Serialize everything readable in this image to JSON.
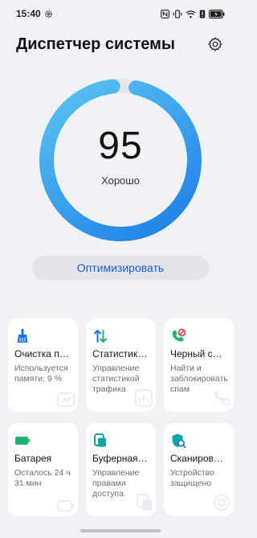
{
  "status_bar": {
    "time": "15:40",
    "icons": [
      "gear-icon",
      "nfc-icon",
      "vibrate-icon",
      "wifi-icon",
      "alert-icon",
      "battery-icon"
    ]
  },
  "header": {
    "title": "Диспетчер системы",
    "settings_icon": "gear-icon"
  },
  "score": {
    "value": "95",
    "label": "Хорошо",
    "fraction": 0.95
  },
  "optimize_button": {
    "label": "Оптимизировать"
  },
  "cards": [
    {
      "title": "Очистка памяти",
      "description": "Используется памяти: 9 %",
      "icon": "broom-icon"
    },
    {
      "title": "Статистика трафика",
      "description": "Управление статистикой трафика",
      "icon": "traffic-arrows-icon"
    },
    {
      "title": "Черный список",
      "description": "Найти и заблокировать спам",
      "icon": "blocked-call-icon"
    },
    {
      "title": "Батарея",
      "description": "Осталось 24 ч 31 мин",
      "icon": "battery-icon"
    },
    {
      "title": "Буферная зона",
      "description": "Управление правами доступа",
      "icon": "clipboard-icon"
    },
    {
      "title": "Сканирование",
      "description": "Устройство защищено",
      "icon": "scan-shield-icon"
    }
  ],
  "colors": {
    "accent": "#1f5cd6",
    "ring_start": "#1b7ee6",
    "ring_end": "#5cc4f3",
    "ring_track": "#e6e7eb",
    "card_icon_blue": "#1a73e8",
    "card_icon_green": "#18b56b",
    "card_icon_teal": "#13a3a8"
  }
}
